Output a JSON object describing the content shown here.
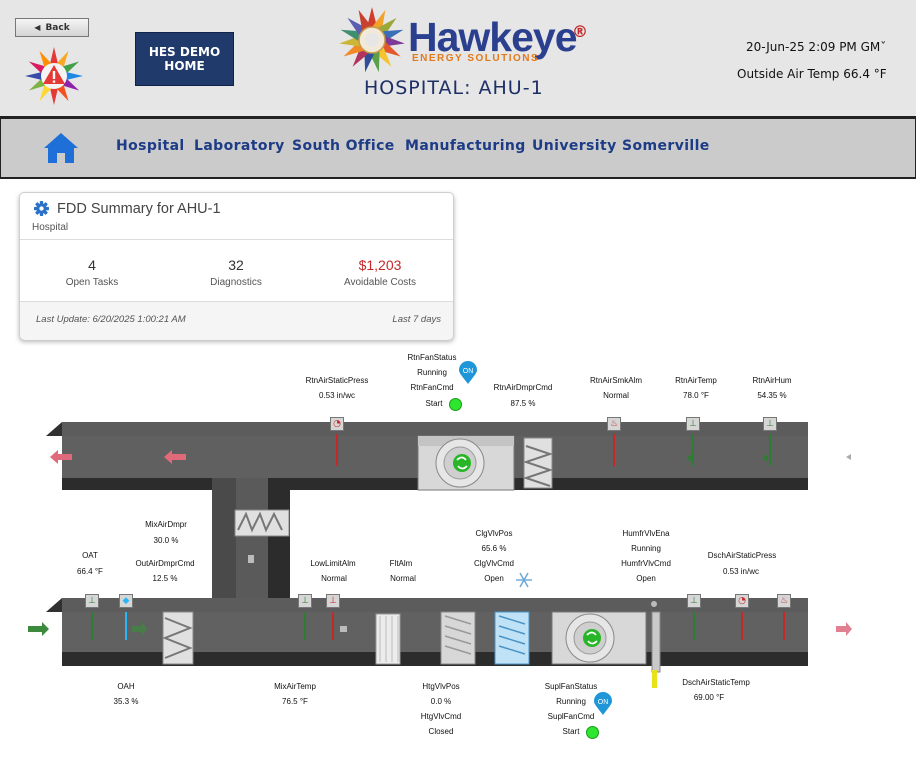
{
  "header": {
    "back_label": "Back",
    "home_button": {
      "line1": "HES DEMO",
      "line2": "HOME"
    },
    "brand_name": "Hawkeye",
    "brand_reg": "®",
    "brand_sub": "ENERGY SOLUTIONS",
    "page_title": "HOSPITAL: AHU-1",
    "datetime": "20-Jun-25 2:09 PM GMˇ",
    "outside_air_temp": "Outside Air Temp  66.4 °F"
  },
  "nav": {
    "items": [
      "Hospital",
      "Laboratory",
      "South Office",
      "Manufacturing",
      "University",
      "Somerville"
    ]
  },
  "fdd": {
    "title": "FDD Summary for AHU-1",
    "subtitle": "Hospital",
    "open_tasks_value": "4",
    "open_tasks_label": "Open Tasks",
    "diagnostics_value": "32",
    "diagnostics_label": "Diagnostics",
    "avoidable_costs_value": "$1,203",
    "avoidable_costs_label": "Avoidable Costs",
    "last_update": "Last Update: 6/20/2025 1:00:21 AM",
    "period": "Last 7 days"
  },
  "points": {
    "rtn_fan_status": {
      "name": "RtnFanStatus",
      "value": "Running",
      "badge": "ON"
    },
    "rtn_fan_cmd": {
      "name": "RtnFanCmd",
      "value": "Start"
    },
    "rtn_air_static_press": {
      "name": "RtnAirStaticPress",
      "value": "0.53 in/wc"
    },
    "rtn_air_dmpr_cmd": {
      "name": "RtnAirDmprCmd",
      "value": "87.5 %"
    },
    "rtn_air_smk_alm": {
      "name": "RtnAirSmkAlm",
      "value": "Normal"
    },
    "rtn_air_temp": {
      "name": "RtnAirTemp",
      "value": "78.0 °F"
    },
    "rtn_air_hum": {
      "name": "RtnAirHum",
      "value": "54.35 %"
    },
    "mix_air_dmpr": {
      "name": "MixAirDmpr",
      "value": "30.0 %"
    },
    "oat": {
      "name": "OAT",
      "value": "66.4 °F"
    },
    "out_air_dmpr_cmd": {
      "name": "OutAirDmprCmd",
      "value": "12.5 %"
    },
    "low_limit_alm": {
      "name": "LowLimitAlm",
      "value": "Normal"
    },
    "flt_alm": {
      "name": "FltAlm",
      "value": "Normal"
    },
    "clg_vlv_pos": {
      "name": "ClgVlvPos",
      "value": "65.6 %"
    },
    "clg_vlv_cmd": {
      "name": "ClgVlvCmd",
      "value": "Open"
    },
    "humfr_vlv_ena": {
      "name": "HumfrVlvEna",
      "value": "Running"
    },
    "humfr_vlv_cmd": {
      "name": "HumfrVlvCmd",
      "value": "Open"
    },
    "dsch_air_static_press": {
      "name": "DschAirStaticPress",
      "value": "0.53 in/wc"
    },
    "oah": {
      "name": "OAH",
      "value": "35.3 %"
    },
    "mix_air_temp": {
      "name": "MixAirTemp",
      "value": "76.5 °F"
    },
    "htg_vlv_pos": {
      "name": "HtgVlvPos",
      "value": "0.0 %"
    },
    "htg_vlv_cmd": {
      "name": "HtgVlvCmd",
      "value": "Closed"
    },
    "supl_fan_status": {
      "name": "SuplFanStatus",
      "value": "Running",
      "badge": "ON"
    },
    "supl_fan_cmd": {
      "name": "SuplFanCmd",
      "value": "Start"
    },
    "dsch_air_static_temp": {
      "name": "DschAirStaticTemp",
      "value": "69.00 °F"
    }
  },
  "colors": {
    "brand_blue": "#2b3f8f",
    "nav_text": "#1d3b86",
    "cost_red": "#c62828",
    "status_green": "#2ee62e",
    "badge_blue": "#1e96d8"
  },
  "icons": [
    "warning-sun-icon",
    "hawkeye-sun-logo",
    "home-icon",
    "gear-icon",
    "fan-icon",
    "snowflake-icon",
    "thermometer-icon",
    "pressure-gauge-icon",
    "smoke-alarm-icon"
  ]
}
